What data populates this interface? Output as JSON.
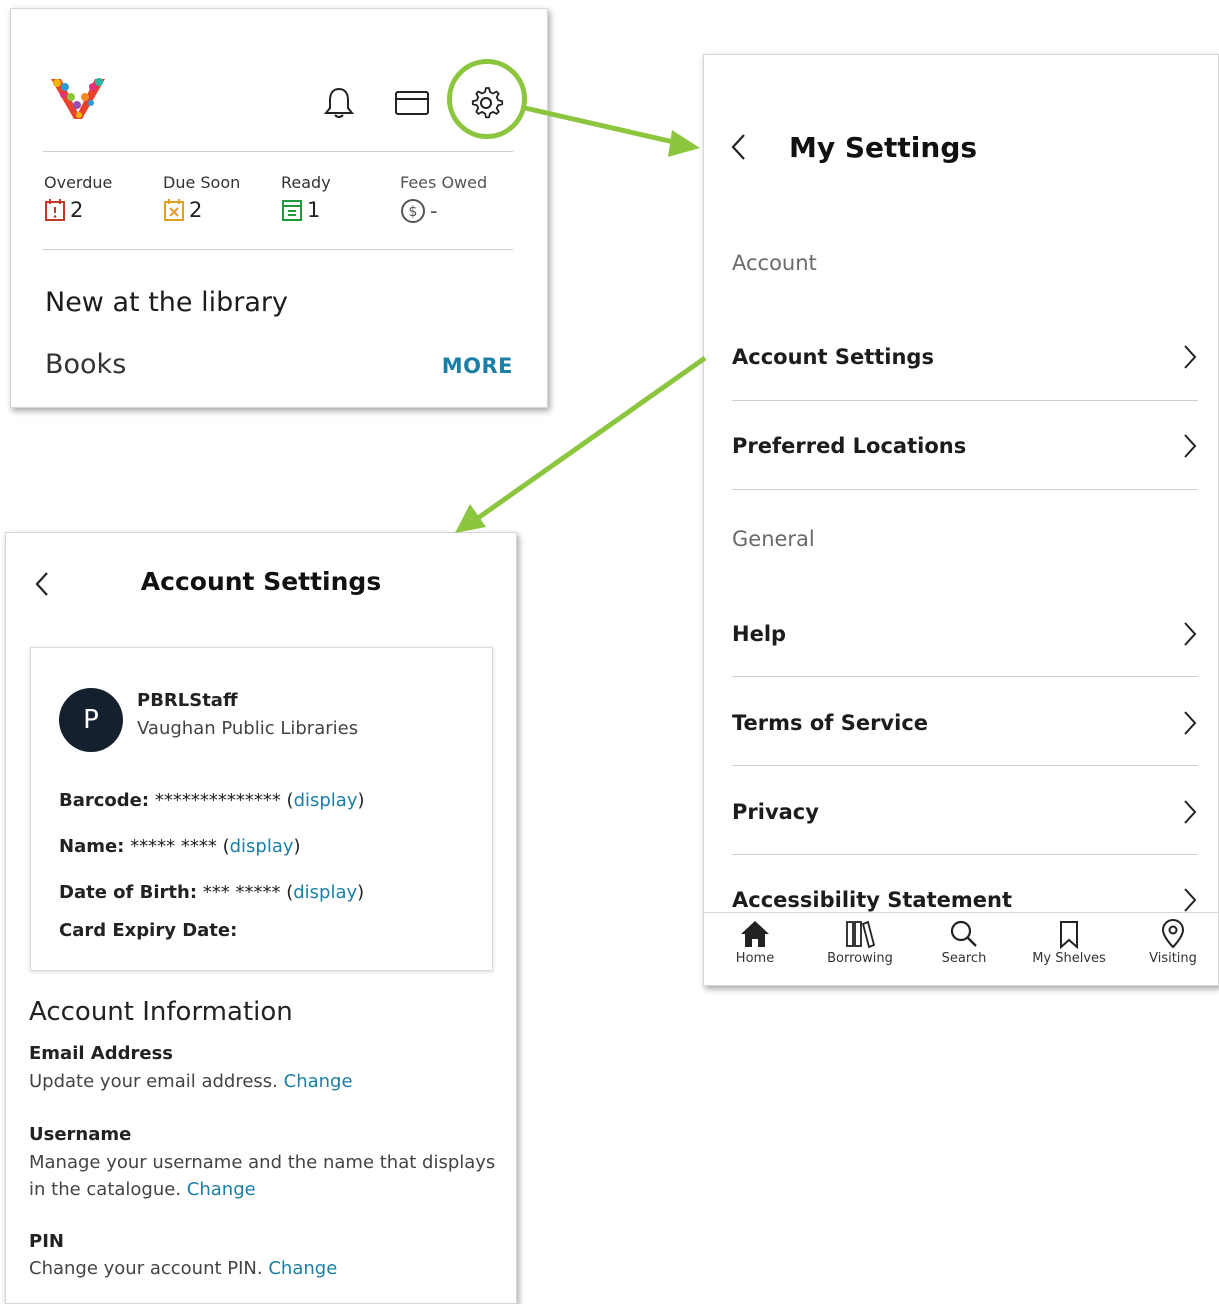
{
  "home": {
    "stats": [
      {
        "label": "Overdue",
        "value": "2",
        "color": "#c0392b"
      },
      {
        "label": "Due Soon",
        "value": "2",
        "color": "#e0a020"
      },
      {
        "label": "Ready",
        "value": "1",
        "color": "#1f9b3a"
      },
      {
        "label": "Fees Owed",
        "value": "-",
        "color": "#555555"
      }
    ],
    "new_title": "New at the library",
    "books_label": "Books",
    "more_label": "MORE"
  },
  "settings": {
    "title": "My Settings",
    "section_account": "Account",
    "section_general": "General",
    "rows": [
      {
        "label": "Account Settings"
      },
      {
        "label": "Preferred Locations"
      },
      {
        "label": "Help"
      },
      {
        "label": "Terms of Service"
      },
      {
        "label": "Privacy"
      },
      {
        "label": "Accessibility Statement"
      }
    ],
    "tabs": [
      {
        "label": "Home",
        "icon": "home-icon"
      },
      {
        "label": "Borrowing",
        "icon": "books-icon"
      },
      {
        "label": "Search",
        "icon": "search-icon"
      },
      {
        "label": "My Shelves",
        "icon": "bookmark-icon"
      },
      {
        "label": "Visiting",
        "icon": "location-pin-icon"
      }
    ]
  },
  "account": {
    "title": "Account Settings",
    "avatar_letter": "P",
    "username": "PBRLStaff",
    "library": "Vaughan Public Libraries",
    "barcode_label": "Barcode:",
    "barcode_value": "**************",
    "name_label": "Name:",
    "name_value": "***** ****",
    "dob_label": "Date of Birth:",
    "dob_value": "*** *****",
    "display_link": "display",
    "expiry_label": "Card Expiry Date:",
    "info_title": "Account Information",
    "email_label": "Email Address",
    "email_desc": "Update your email address.",
    "username_label": "Username",
    "username_desc": "Manage your username and the name that displays in the catalogue.",
    "pin_label": "PIN",
    "pin_desc": "Change your account PIN.",
    "change_link": "Change"
  },
  "accent_color": "#8cc63f",
  "link_color": "#1a7fa6"
}
